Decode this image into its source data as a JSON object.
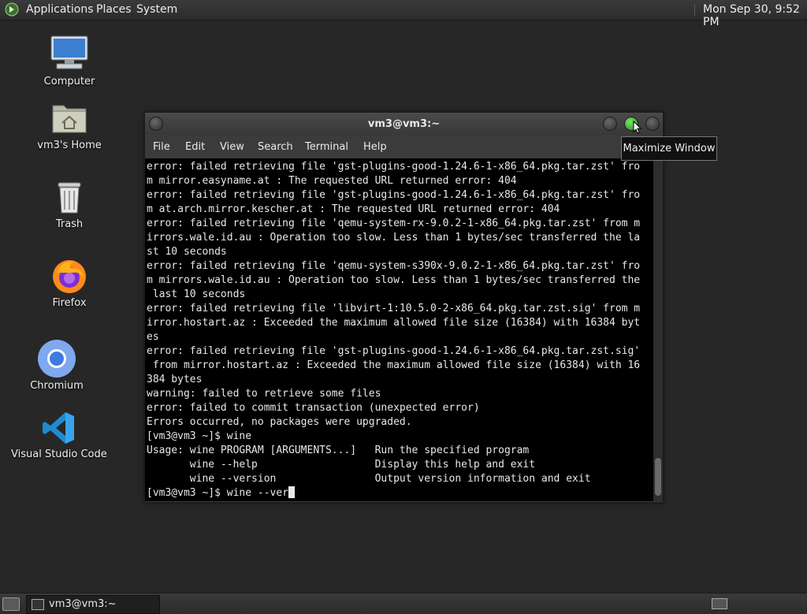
{
  "top_panel": {
    "applications": "Applications",
    "places": "Places",
    "system": "System",
    "clock": "Mon Sep 30,  9:52 PM"
  },
  "desktop_icons": {
    "computer": "Computer",
    "home": "vm3's Home",
    "trash": "Trash",
    "firefox": "Firefox",
    "chromium": "Chromium",
    "vscode": "Visual Studio Code"
  },
  "window": {
    "title": "vm3@vm3:~",
    "menu": [
      "File",
      "Edit",
      "View",
      "Search",
      "Terminal",
      "Help"
    ]
  },
  "terminal": {
    "lines": [
      "error: failed retrieving file 'gst-plugins-good-1.24.6-1-x86_64.pkg.tar.zst' fro",
      "m mirror.easyname.at : The requested URL returned error: 404",
      "error: failed retrieving file 'gst-plugins-good-1.24.6-1-x86_64.pkg.tar.zst' fro",
      "m at.arch.mirror.kescher.at : The requested URL returned error: 404",
      "error: failed retrieving file 'qemu-system-rx-9.0.2-1-x86_64.pkg.tar.zst' from m",
      "irrors.wale.id.au : Operation too slow. Less than 1 bytes/sec transferred the la",
      "st 10 seconds",
      "error: failed retrieving file 'qemu-system-s390x-9.0.2-1-x86_64.pkg.tar.zst' fro",
      "m mirrors.wale.id.au : Operation too slow. Less than 1 bytes/sec transferred the",
      " last 10 seconds",
      "error: failed retrieving file 'libvirt-1:10.5.0-2-x86_64.pkg.tar.zst.sig' from m",
      "irror.hostart.az : Exceeded the maximum allowed file size (16384) with 16384 byt",
      "es",
      "error: failed retrieving file 'gst-plugins-good-1.24.6-1-x86_64.pkg.tar.zst.sig'",
      " from mirror.hostart.az : Exceeded the maximum allowed file size (16384) with 16",
      "384 bytes",
      "warning: failed to retrieve some files",
      "error: failed to commit transaction (unexpected error)",
      "Errors occurred, no packages were upgraded.",
      "[vm3@vm3 ~]$ wine",
      "Usage: wine PROGRAM [ARGUMENTS...]   Run the specified program",
      "       wine --help                   Display this help and exit",
      "       wine --version                Output version information and exit"
    ],
    "prompt": "[vm3@vm3 ~]$ wine --ver"
  },
  "tooltip": "Maximize Window",
  "taskbar": {
    "task_label": "vm3@vm3:~"
  }
}
